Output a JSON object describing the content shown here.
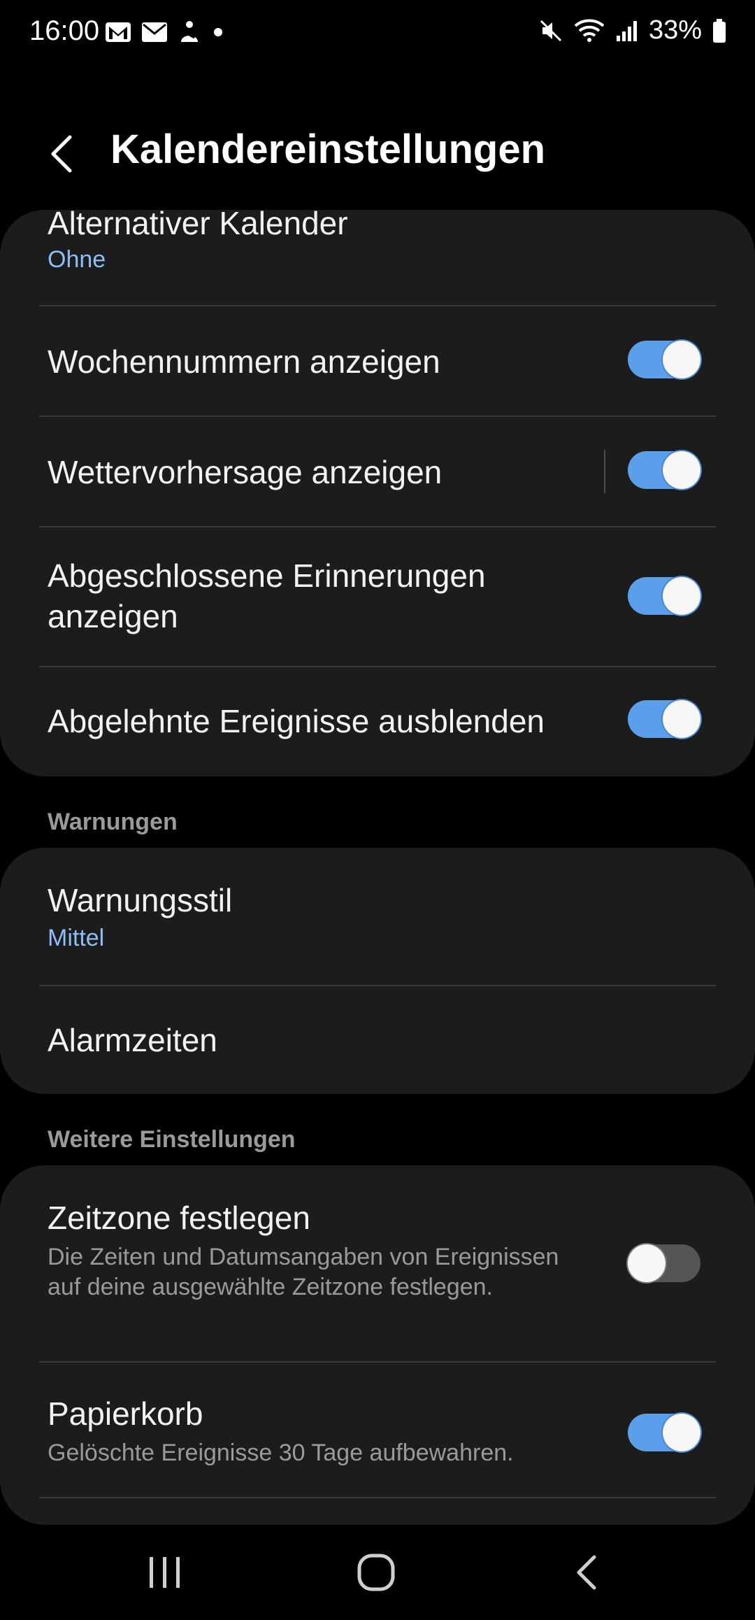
{
  "status_bar": {
    "time": "16:00",
    "battery": "33%",
    "icons_left": [
      "gmail-icon",
      "mail-icon",
      "assistant-icon",
      "dot-icon"
    ],
    "icons_right": [
      "mute-icon",
      "wifi-icon",
      "signal-icon",
      "battery-icon"
    ]
  },
  "header": {
    "title": "Kalendereinstellungen"
  },
  "card1": {
    "alt_calendar": {
      "title": "Alternativer Kalender",
      "value": "Ohne"
    },
    "week_numbers": {
      "title": "Wochennummern anzeigen",
      "enabled": true
    },
    "weather": {
      "title": "Wettervorhersage anzeigen",
      "enabled": true
    },
    "completed_reminders": {
      "title": "Abgeschlossene Erinnerungen anzeigen",
      "enabled": true
    },
    "hide_declined": {
      "title": "Abgelehnte Ereignisse ausblenden",
      "enabled": true
    }
  },
  "section_warnings": {
    "header": "Warnungen",
    "style": {
      "title": "Warnungsstil",
      "value": "Mittel"
    },
    "alarm_times": {
      "title": "Alarmzeiten"
    }
  },
  "section_more": {
    "header": "Weitere Einstellungen",
    "timezone": {
      "title": "Zeitzone festlegen",
      "desc": "Die Zeiten und Datumsangaben von Ereignissen auf deine ausgewählte Zeitzone festlegen.",
      "enabled": false
    },
    "trash": {
      "title": "Papierkorb",
      "desc": "Gelöschte Ereignisse 30 Tage aufbewahren.",
      "enabled": true
    }
  },
  "nav_bar": {
    "items": [
      "recent-apps-icon",
      "home-icon",
      "back-icon"
    ]
  },
  "colors": {
    "accent": "#5b9ee9",
    "subtitle_blue": "#8fbdf5",
    "card_bg": "#1c1c1c"
  }
}
